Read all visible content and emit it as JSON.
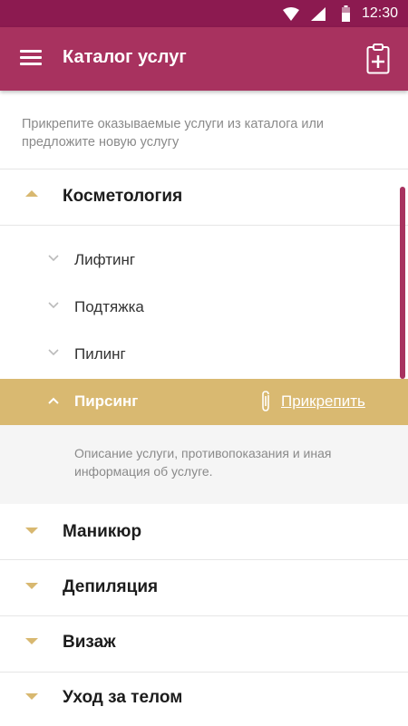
{
  "status_bar": {
    "time": "12:30"
  },
  "app_bar": {
    "title": "Каталог услуг"
  },
  "intro": "Прикрепите оказываемые услуги из каталога или предложите новую услугу",
  "categories": [
    {
      "label": "Косметология",
      "expanded": true
    },
    {
      "label": "Маникюр",
      "expanded": false
    },
    {
      "label": "Депиляция",
      "expanded": false
    },
    {
      "label": "Визаж",
      "expanded": false
    },
    {
      "label": "Уход за телом",
      "expanded": false
    }
  ],
  "services": [
    {
      "label": "Лифтинг"
    },
    {
      "label": "Подтяжка"
    },
    {
      "label": "Пилинг"
    }
  ],
  "selected_service": {
    "label": "Пирсинг",
    "attach_label": "Прикрепить",
    "description": "Описание услуги, противопоказания и иная информация об услуге."
  },
  "colors": {
    "status_bar": "#8c1a50",
    "app_bar": "#a8325f",
    "accent_gold": "#d9b971"
  }
}
